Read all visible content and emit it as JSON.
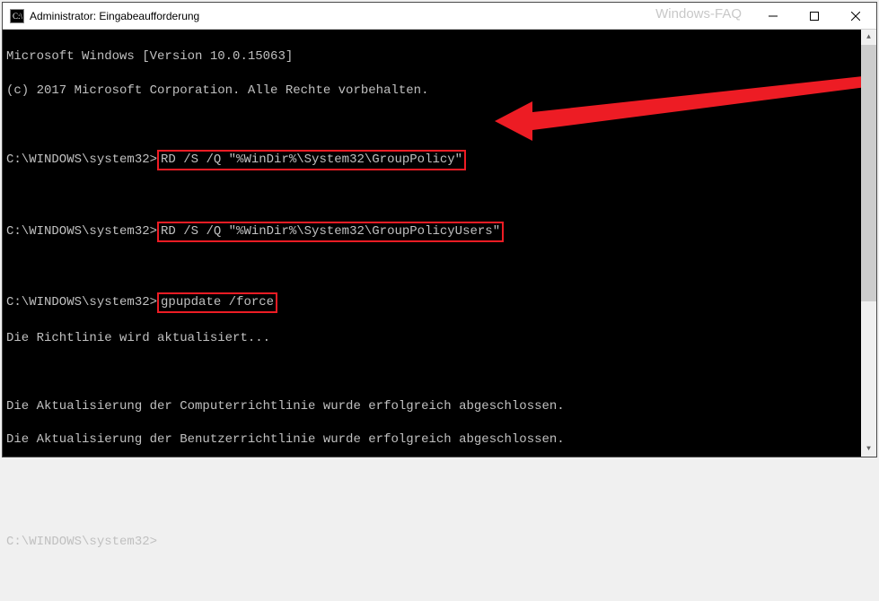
{
  "window": {
    "title": "Administrator: Eingabeaufforderung",
    "watermark": "Windows-FAQ"
  },
  "terminal": {
    "header1": "Microsoft Windows [Version 10.0.15063]",
    "header2": "(c) 2017 Microsoft Corporation. Alle Rechte vorbehalten.",
    "prompt": "C:\\WINDOWS\\system32>",
    "cmd1": "RD /S /Q \"%WinDir%\\System32\\GroupPolicy\"",
    "cmd2": "RD /S /Q \"%WinDir%\\System32\\GroupPolicyUsers\"",
    "cmd3": "gpupdate /force",
    "out1": "Die Richtlinie wird aktualisiert...",
    "out2": "Die Aktualisierung der Computerrichtlinie wurde erfolgreich abgeschlossen.",
    "out3": "Die Aktualisierung der Benutzerrichtlinie wurde erfolgreich abgeschlossen."
  },
  "colors": {
    "highlight_border": "#ed1c24",
    "arrow_fill": "#ed1c24"
  }
}
